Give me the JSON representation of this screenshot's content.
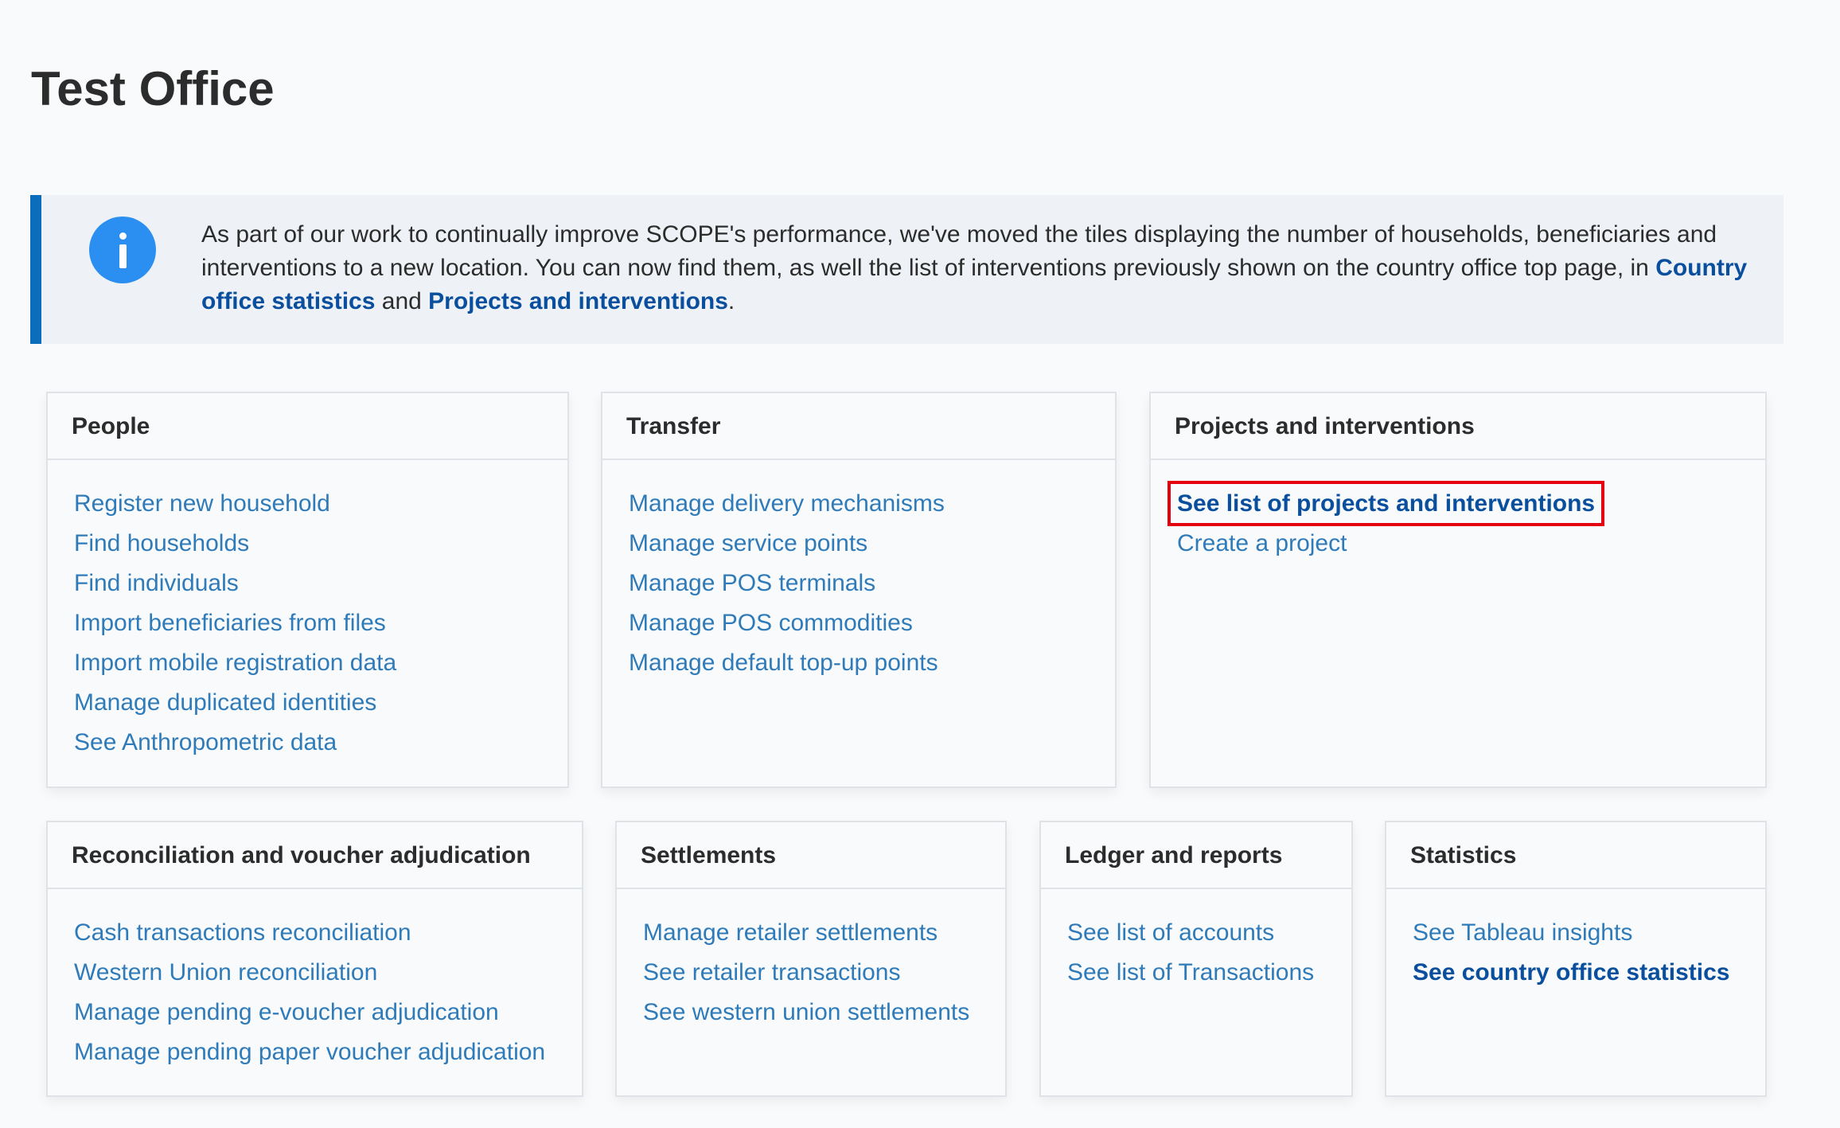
{
  "page": {
    "title": "Test Office"
  },
  "notice": {
    "icon": "info-icon",
    "text_before": "As part of our work to continually improve SCOPE's performance, we've moved the tiles displaying the number of households, beneficiaries and interventions to a new location. You can now find them, as well the list of interventions previously shown on the country office top page, in ",
    "link_country_office_statistics": "Country office statistics",
    "text_and": " and ",
    "link_projects_and_interventions": "Projects and interventions",
    "text_after": "."
  },
  "cards": {
    "people": {
      "title": "People",
      "links": [
        "Register new household",
        "Find households",
        "Find individuals",
        "Import beneficiaries from files",
        "Import mobile registration data",
        "Manage duplicated identities",
        "See Anthropometric data"
      ]
    },
    "transfer": {
      "title": "Transfer",
      "links": [
        "Manage delivery mechanisms",
        "Manage service points",
        "Manage POS terminals",
        "Manage POS commodities",
        "Manage default top-up points"
      ]
    },
    "projects": {
      "title": "Projects and interventions",
      "links": [
        "See list of projects and interventions",
        "Create a project"
      ]
    },
    "reconciliation": {
      "title": "Reconciliation and voucher adjudication",
      "links": [
        "Cash transactions reconciliation",
        "Western Union reconciliation",
        "Manage pending e-voucher adjudication",
        "Manage pending paper voucher adjudication"
      ]
    },
    "settlements": {
      "title": "Settlements",
      "links": [
        "Manage retailer settlements",
        "See retailer transactions",
        "See western union settlements"
      ]
    },
    "ledger": {
      "title": "Ledger and reports",
      "links": [
        "See list of accounts",
        "See list of Transactions"
      ]
    },
    "statistics": {
      "title": "Statistics",
      "links": [
        "See Tableau insights",
        "See country office statistics"
      ]
    }
  },
  "colors": {
    "link": "#2f7bb9",
    "link_strong": "#0a4f9e",
    "notice_border": "#0a6ebd",
    "info_icon": "#2b8ff2",
    "highlight": "#e4000f"
  }
}
